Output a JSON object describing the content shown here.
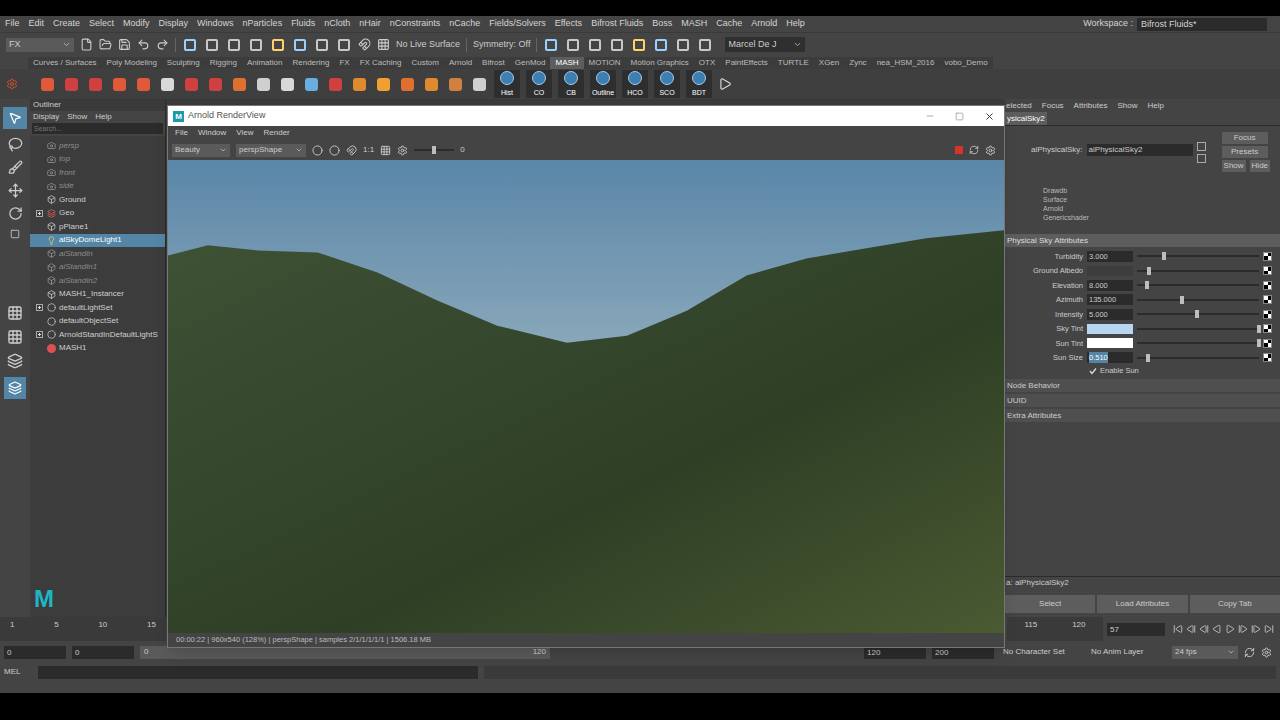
{
  "menu_bar": {
    "items": [
      "File",
      "Edit",
      "Create",
      "Select",
      "Modify",
      "Display",
      "Windows",
      "nParticles",
      "Fluids",
      "nCloth",
      "nHair",
      "nConstraints",
      "nCache",
      "Fields/Solvers",
      "Effects",
      "Bifrost Fluids",
      "Boss",
      "MASH",
      "Cache",
      "Arnold",
      "Help"
    ],
    "workspace_label": "Workspace :",
    "workspace_value": "Bifrost Fluids*"
  },
  "status_line": {
    "mode": "FX",
    "live_surface": "No Live Surface",
    "symmetry": "Symmetry: Off",
    "user": "Marcel De J"
  },
  "shelf": {
    "tabs": [
      {
        "label": "Curves / Surfaces",
        "selected": false
      },
      {
        "label": "Poly Modeling",
        "selected": false
      },
      {
        "label": "Sculpting",
        "selected": false
      },
      {
        "label": "Rigging",
        "selected": false
      },
      {
        "label": "Animation",
        "selected": false
      },
      {
        "label": "Rendering",
        "selected": false
      },
      {
        "label": "FX",
        "selected": false
      },
      {
        "label": "FX Caching",
        "selected": false
      },
      {
        "label": "Custom",
        "selected": false
      },
      {
        "label": "Arnold",
        "selected": false
      },
      {
        "label": "Bifrost",
        "selected": false
      },
      {
        "label": "GenMod",
        "selected": false
      },
      {
        "label": "MASH",
        "selected": true
      },
      {
        "label": "MOTION",
        "selected": false
      },
      {
        "label": "Motion Graphics",
        "selected": false
      },
      {
        "label": "OTX",
        "selected": false
      },
      {
        "label": "PaintEffects",
        "selected": false
      },
      {
        "label": "TURTLE",
        "selected": false
      },
      {
        "label": "XGen",
        "selected": false
      },
      {
        "label": "Zync",
        "selected": false
      },
      {
        "label": "nea_HSM_2016",
        "selected": false
      },
      {
        "label": "vobo_Demo",
        "selected": false
      }
    ],
    "labeled_buttons": [
      "Hist",
      "CO",
      "CB",
      "Outline",
      "HCO",
      "SCO",
      "BDT"
    ]
  },
  "outliner": {
    "title": "Outliner",
    "menu": [
      "Display",
      "Show",
      "Help"
    ],
    "search_placeholder": "Search...",
    "maya_logo": "M",
    "items": [
      {
        "label": "persp",
        "kind": "camera",
        "greyed": true,
        "selected": false,
        "expandable": false
      },
      {
        "label": "top",
        "kind": "camera",
        "greyed": true,
        "selected": false,
        "expandable": false
      },
      {
        "label": "front",
        "kind": "camera",
        "greyed": true,
        "selected": false,
        "expandable": false
      },
      {
        "label": "side",
        "kind": "camera",
        "greyed": true,
        "selected": false,
        "expandable": false
      },
      {
        "label": "Ground",
        "kind": "transform",
        "greyed": false,
        "selected": false,
        "expandable": false
      },
      {
        "label": "Geo",
        "kind": "group",
        "greyed": false,
        "selected": false,
        "expandable": true
      },
      {
        "label": "pPlane1",
        "kind": "transform",
        "greyed": false,
        "selected": false,
        "expandable": false
      },
      {
        "label": "aiSkyDomeLight1",
        "kind": "light",
        "greyed": false,
        "selected": true,
        "expandable": false
      },
      {
        "label": "aiStandIn",
        "kind": "standin",
        "greyed": true,
        "selected": false,
        "expandable": false
      },
      {
        "label": "aiStandIn1",
        "kind": "standin",
        "greyed": true,
        "selected": false,
        "expandable": false
      },
      {
        "label": "aiStandIn2",
        "kind": "standin",
        "greyed": true,
        "selected": false,
        "expandable": false
      },
      {
        "label": "MASH1_Instancer",
        "kind": "transform",
        "greyed": false,
        "selected": false,
        "expandable": false
      },
      {
        "label": "defaultLightSet",
        "kind": "set",
        "greyed": false,
        "selected": false,
        "expandable": true
      },
      {
        "label": "defaultObjectSet",
        "kind": "set",
        "greyed": false,
        "selected": false,
        "expandable": false
      },
      {
        "label": "ArnoldStandInDefaultLightS",
        "kind": "set",
        "greyed": false,
        "selected": false,
        "expandable": true
      },
      {
        "label": "MASH1",
        "kind": "mash",
        "greyed": false,
        "selected": false,
        "expandable": false
      }
    ]
  },
  "render_view": {
    "title": "Arnold RenderView",
    "icon_glyph": "M",
    "menu": [
      "File",
      "Window",
      "View",
      "Render"
    ],
    "aov": "Beauty",
    "camera": "perspShape",
    "ratio": "1:1",
    "exposure": "0",
    "exposure_level": 0.5,
    "status": "00:00:22 | 960x540 (128%) | perspShape | samples 2/1/1/1/1/1 | 1506.18 MB"
  },
  "attribute_editor": {
    "menu": [
      "elected",
      "Focus",
      "Attributes",
      "Show",
      "Help"
    ],
    "tab": "ysicalSky2",
    "node_label": "aiPhysicalSky:",
    "node_value": "aiPhysicalSky2",
    "buttons": [
      "Focus",
      "Presets"
    ],
    "show_hide": [
      "Show",
      "Hide"
    ],
    "classification": [
      "Drawdb",
      "Surface",
      "Arnold",
      "Genericshader"
    ],
    "section": {
      "title": "Physical Sky Attributes",
      "expanded": true
    },
    "attributes": [
      {
        "label": "Turbidity",
        "kind": "number",
        "value": "3.000",
        "level": 0.22,
        "editing": false
      },
      {
        "label": "Ground Albedo",
        "kind": "color",
        "color": "#3d3d3d",
        "level": 0.1
      },
      {
        "label": "Elevation",
        "kind": "number",
        "value": "8.000",
        "level": 0.08,
        "editing": false
      },
      {
        "label": "Azimuth",
        "kind": "number",
        "value": "135.000",
        "level": 0.37,
        "editing": false
      },
      {
        "label": "Intensity",
        "kind": "number",
        "value": "5.000",
        "level": 0.49,
        "editing": false
      },
      {
        "label": "Sky Tint",
        "kind": "color",
        "color": "#b6d6f2",
        "level": 1.0
      },
      {
        "label": "Sun Tint",
        "kind": "color",
        "color": "#ffffff",
        "level": 1.0
      },
      {
        "label": "Sun Size",
        "kind": "number",
        "value": "0.510",
        "level": 0.09,
        "editing": true
      }
    ],
    "checkbox": {
      "label": "Enable Sun",
      "checked": true
    },
    "collapsed_sections": [
      "Node Behavior",
      "UUID",
      "Extra Attributes"
    ],
    "footer_node": "a: aiPhysicalSky2",
    "footer_buttons": [
      "Select",
      "Load Attributes",
      "Copy Tab"
    ]
  },
  "time_slider": {
    "left_ticks": [
      "1",
      "5",
      "10",
      "15"
    ],
    "right_ticks": [
      "115",
      "120"
    ],
    "current_frame": "57"
  },
  "range_slider": {
    "start": "0",
    "inner_start": "0",
    "bar_start": "0",
    "bar_end": "120",
    "inner_end": "120",
    "end": "200",
    "character_set": "No Character Set",
    "anim_layer": "No Anim Layer",
    "fps": "24 fps"
  },
  "command_line": {
    "label": "MEL"
  }
}
